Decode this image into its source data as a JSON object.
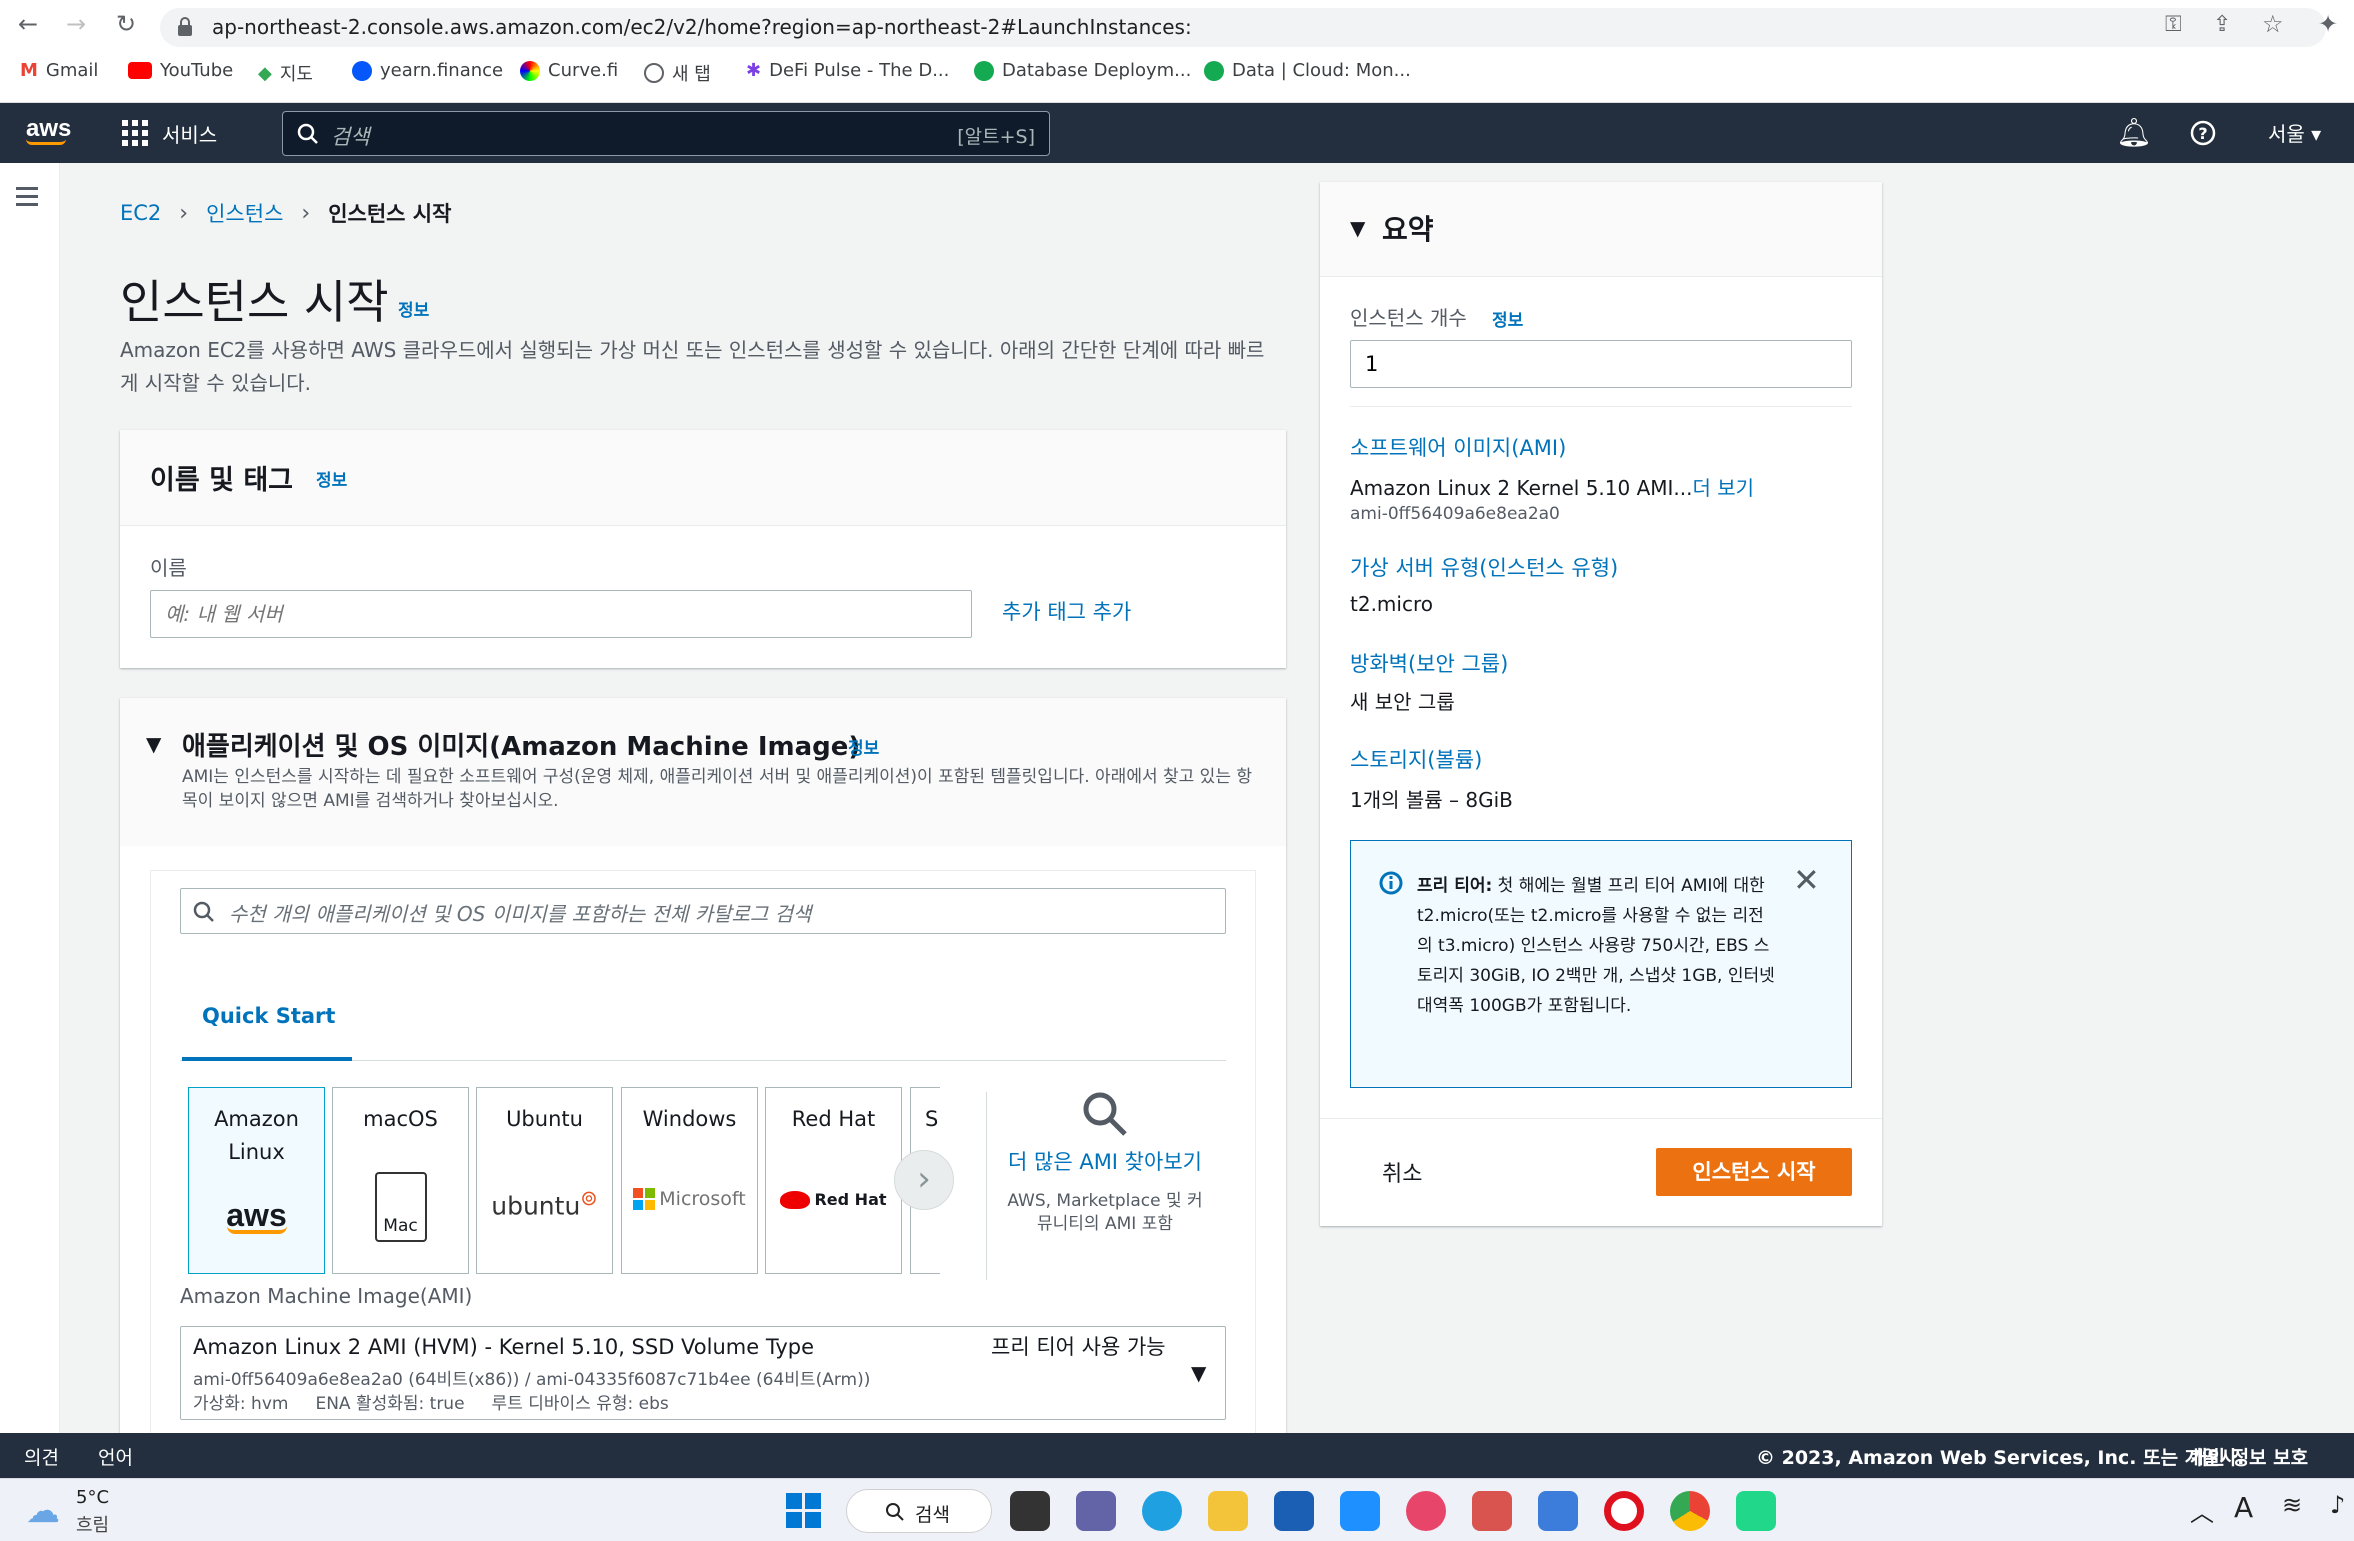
{
  "browser": {
    "url": "ap-northeast-2.console.aws.amazon.com/ec2/v2/home?region=ap-northeast-2#LaunchInstances:",
    "bookmarks": [
      "Gmail",
      "YouTube",
      "지도",
      "yearn.finance",
      "Curve.fi",
      "새 탭",
      "DeFi Pulse - The D...",
      "Database Deploym...",
      "Data | Cloud: Mon..."
    ]
  },
  "awsnav": {
    "services": "서비스",
    "search_placeholder": "검색",
    "search_shortcut": "[알트+S]",
    "region": "서울"
  },
  "breadcrumb": [
    "EC2",
    "인스턴스",
    "인스턴스 시작"
  ],
  "page": {
    "title": "인스턴스 시작",
    "info": "정보",
    "description": "Amazon EC2를 사용하면 AWS 클라우드에서 실행되는 가상 머신 또는 인스턴스를 생성할 수 있습니다. 아래의 간단한 단계에 따라 빠르게 시작할 수 있습니다."
  },
  "name_tags": {
    "title": "이름 및 태그",
    "info": "정보",
    "name_label": "이름",
    "name_placeholder": "예: 내 웹 서버",
    "add_tags": "추가 태그 추가"
  },
  "ami_section": {
    "title": "애플리케이션 및 OS 이미지(Amazon Machine Image)",
    "info": "정보",
    "description": "AMI는 인스턴스를 시작하는 데 필요한 소프트웨어 구성(운영 체제, 애플리케이션 서버 및 애플리케이션)이 포함된 템플릿입니다. 아래에서 찾고 있는 항목이 보이지 않으면 AMI를 검색하거나 찾아보십시오.",
    "search_placeholder": "수천 개의 애플리케이션 및 OS 이미지를 포함하는 전체 카탈로그 검색",
    "tab": "Quick Start",
    "cards": [
      {
        "label": "Amazon Linux",
        "logo": "aws"
      },
      {
        "label": "macOS",
        "logo": "Mac"
      },
      {
        "label": "Ubuntu",
        "logo": "ubuntu"
      },
      {
        "label": "Windows",
        "logo": "Microsoft"
      },
      {
        "label": "Red Hat",
        "logo": "Red Hat"
      },
      {
        "label": "SI",
        "logo": ""
      }
    ],
    "more_ami": "더 많은 AMI 찾아보기",
    "more_ami_sub": "AWS, Marketplace 및 커뮤니티의 AMI 포함",
    "ami_label": "Amazon Machine Image(AMI)",
    "selected_ami": {
      "name": "Amazon Linux 2 AMI (HVM) - Kernel 5.10, SSD Volume Type",
      "ids": "ami-0ff56409a6e8ea2a0 (64비트(x86)) / ami-04335f6087c71b4ee (64비트(Arm))",
      "meta": "가상화: hvm     ENA 활성화됨: true     루트 디바이스 유형: ebs",
      "badge": "프리 티어 사용 가능"
    }
  },
  "summary": {
    "title": "요약",
    "count_label": "인스턴스 개수",
    "info": "정보",
    "count_value": "1",
    "software_label": "소프트웨어 이미지(AMI)",
    "software_value": "Amazon Linux 2 Kernel 5.10 AMI...",
    "software_more": "더 보기",
    "software_id": "ami-0ff56409a6e8ea2a0",
    "type_label": "가상 서버 유형(인스턴스 유형)",
    "type_value": "t2.micro",
    "firewall_label": "방화벽(보안 그룹)",
    "firewall_value": "새 보안 그룹",
    "storage_label": "스토리지(볼륨)",
    "storage_value": "1개의 볼륨 – 8GiB",
    "free_tier_bold": "프리 티어:",
    "free_tier_text": " 첫 해에는 월별 프리 티어 AMI에 대한 t2.micro(또는 t2.micro를 사용할 수 없는 리전의 t3.micro) 인스턴스 사용량 750시간, EBS 스토리지 30GiB, IO 2백만 개, 스냅샷 1GB, 인터넷 대역폭 100GB가 포함됩니다.",
    "cancel": "취소",
    "launch": "인스턴스 시작"
  },
  "footer": {
    "feedback": "의견",
    "language": "언어",
    "copyright": "© 2023, Amazon Web Services, Inc. 또는 계열사.",
    "privacy": "개인 정보 보호"
  },
  "taskbar": {
    "temp": "5°C",
    "weather": "흐림",
    "search": "검색"
  },
  "colors": {
    "aws_nav": "#232f3e",
    "accent_orange": "#ec7211",
    "link": "#0073bb"
  }
}
